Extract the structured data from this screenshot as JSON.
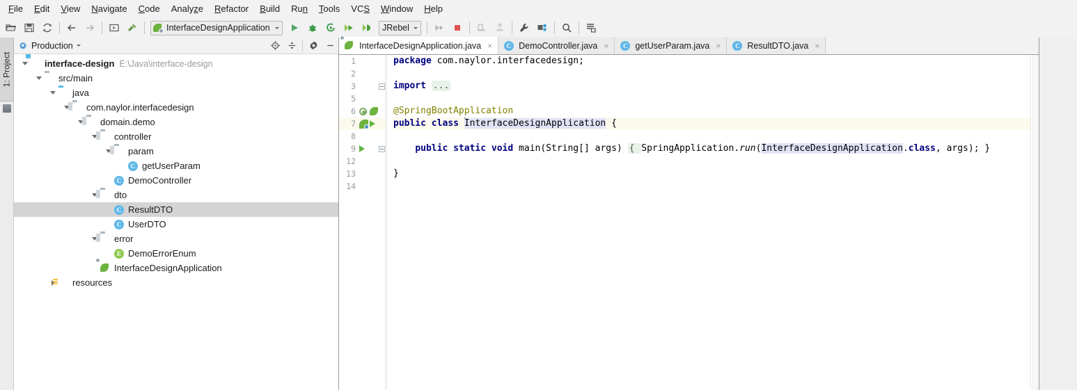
{
  "menubar": {
    "items": [
      {
        "label": "File",
        "mnemonic": "F"
      },
      {
        "label": "Edit",
        "mnemonic": "E"
      },
      {
        "label": "View",
        "mnemonic": "V"
      },
      {
        "label": "Navigate",
        "mnemonic": "N"
      },
      {
        "label": "Code",
        "mnemonic": "C"
      },
      {
        "label": "Analyze",
        "mnemonic": "z"
      },
      {
        "label": "Refactor",
        "mnemonic": "R"
      },
      {
        "label": "Build",
        "mnemonic": "B"
      },
      {
        "label": "Run",
        "mnemonic": "n"
      },
      {
        "label": "Tools",
        "mnemonic": "T"
      },
      {
        "label": "VCS",
        "mnemonic": "S"
      },
      {
        "label": "Window",
        "mnemonic": "W"
      },
      {
        "label": "Help",
        "mnemonic": "H"
      }
    ]
  },
  "toolbar": {
    "buttons": [
      {
        "name": "open-folder-icon",
        "tip": "Open"
      },
      {
        "name": "save-all-icon",
        "tip": "Save All"
      },
      {
        "name": "sync-refresh-icon",
        "tip": "Synchronize"
      },
      {
        "name": "back-arrow-icon",
        "tip": "Back"
      },
      {
        "name": "forward-arrow-icon",
        "tip": "Forward"
      },
      {
        "name": "last-edit-location-icon",
        "tip": "Last Edit Location"
      },
      {
        "name": "build-hammer-icon",
        "tip": "Build Project"
      }
    ],
    "run_config": {
      "label": "InterfaceDesignApplication",
      "icon": "spring-boot-icon"
    },
    "run_buttons": [
      {
        "name": "run-button",
        "tip": "Run"
      },
      {
        "name": "debug-button",
        "tip": "Debug"
      },
      {
        "name": "run-with-coverage-button",
        "tip": "Run with Coverage"
      },
      {
        "name": "jrebel-debug-button",
        "tip": "Debug with JRebel"
      },
      {
        "name": "jrebel-run-button",
        "tip": "Run with JRebel"
      }
    ],
    "jrebel": {
      "label": "JRebel"
    },
    "right_buttons": [
      {
        "name": "attach-profiler-icon",
        "tip": "Profiler"
      },
      {
        "name": "stop-button",
        "tip": "Stop"
      },
      {
        "name": "update-app-icon",
        "tip": "Update Application"
      },
      {
        "name": "rerun-icon",
        "tip": "Rerun"
      },
      {
        "name": "settings-wrench-icon",
        "tip": "Settings"
      },
      {
        "name": "project-structure-icon",
        "tip": "Project Structure"
      },
      {
        "name": "search-everywhere-icon",
        "tip": "Search Everywhere"
      },
      {
        "name": "database-icon",
        "tip": "Database"
      }
    ]
  },
  "toolstrip": {
    "label": "1: Project"
  },
  "project_panel": {
    "scope": "Production",
    "actions": [
      {
        "name": "locate-target-icon",
        "tip": "Select Opened File"
      },
      {
        "name": "collapse-all-icon",
        "tip": "Collapse All"
      },
      {
        "name": "gear-settings-icon",
        "tip": "Settings"
      },
      {
        "name": "hide-panel-icon",
        "tip": "Hide"
      }
    ],
    "tree": [
      {
        "label": "interface-design",
        "path": "E:\\Java\\interface-design",
        "icon": "module-icon",
        "indent": 0,
        "twist": "down",
        "bold": true,
        "selected": false
      },
      {
        "label": "src/main",
        "path": "",
        "icon": "folder-icon",
        "indent": 1,
        "twist": "down",
        "bold": false,
        "selected": false
      },
      {
        "label": "java",
        "path": "",
        "icon": "source-root-icon",
        "indent": 2,
        "twist": "down",
        "bold": false,
        "selected": false
      },
      {
        "label": "com.naylor.interfacedesign",
        "path": "",
        "icon": "package-icon",
        "indent": 3,
        "twist": "down",
        "bold": false,
        "selected": false
      },
      {
        "label": "domain.demo",
        "path": "",
        "icon": "package-icon",
        "indent": 4,
        "twist": "down",
        "bold": false,
        "selected": false
      },
      {
        "label": "controller",
        "path": "",
        "icon": "package-icon",
        "indent": 5,
        "twist": "down",
        "bold": false,
        "selected": false
      },
      {
        "label": "param",
        "path": "",
        "icon": "package-icon",
        "indent": 6,
        "twist": "down",
        "bold": false,
        "selected": false
      },
      {
        "label": "getUserParam",
        "path": "",
        "icon": "java-class-icon",
        "indent": 7,
        "twist": "none",
        "bold": false,
        "selected": false
      },
      {
        "label": "DemoController",
        "path": "",
        "icon": "java-class-icon",
        "indent": 6,
        "twist": "none",
        "bold": false,
        "selected": false
      },
      {
        "label": "dto",
        "path": "",
        "icon": "package-icon",
        "indent": 5,
        "twist": "down",
        "bold": false,
        "selected": false
      },
      {
        "label": "ResultDTO",
        "path": "",
        "icon": "java-class-icon",
        "indent": 6,
        "twist": "none",
        "bold": false,
        "selected": true
      },
      {
        "label": "UserDTO",
        "path": "",
        "icon": "java-class-icon",
        "indent": 6,
        "twist": "none",
        "bold": false,
        "selected": false
      },
      {
        "label": "error",
        "path": "",
        "icon": "package-icon",
        "indent": 5,
        "twist": "down",
        "bold": false,
        "selected": false
      },
      {
        "label": "DemoErrorEnum",
        "path": "",
        "icon": "java-enum-icon",
        "indent": 6,
        "twist": "none",
        "bold": false,
        "selected": false
      },
      {
        "label": "InterfaceDesignApplication",
        "path": "",
        "icon": "spring-boot-class-icon",
        "indent": 5,
        "twist": "none",
        "bold": false,
        "selected": false
      },
      {
        "label": "resources",
        "path": "",
        "icon": "resources-root-icon",
        "indent": 2,
        "twist": "right",
        "bold": false,
        "selected": false
      }
    ]
  },
  "editor": {
    "tabs": [
      {
        "label": "InterfaceDesignApplication.java",
        "icon": "spring-boot-class-icon",
        "active": true,
        "close": "×"
      },
      {
        "label": "DemoController.java",
        "icon": "java-class-icon",
        "active": false,
        "close": "×"
      },
      {
        "label": "getUserParam.java",
        "icon": "java-class-icon",
        "active": false,
        "close": "×"
      },
      {
        "label": "ResultDTO.java",
        "icon": "java-class-icon",
        "active": false,
        "close": "×"
      }
    ],
    "lines": [
      {
        "num": "1",
        "gutter": [],
        "fold": "",
        "caretline": false,
        "tokens": [
          {
            "t": "package",
            "c": "kw"
          },
          {
            "t": " com.naylor.interfacedesign;",
            "c": ""
          }
        ]
      },
      {
        "num": "2",
        "gutter": [],
        "fold": "",
        "caretline": false,
        "tokens": []
      },
      {
        "num": "3",
        "gutter": [],
        "fold": "minus",
        "caretline": false,
        "tokens": [
          {
            "t": "import",
            "c": "kw"
          },
          {
            "t": " ",
            "c": ""
          },
          {
            "t": "...",
            "c": "fold-ph"
          }
        ]
      },
      {
        "num": "5",
        "gutter": [],
        "fold": "",
        "caretline": false,
        "tokens": []
      },
      {
        "num": "6",
        "gutter": [
          "bean-icon",
          "spring-leaf-icon"
        ],
        "fold": "",
        "caretline": false,
        "tokens": [
          {
            "t": "@SpringBootApplication",
            "c": "ann"
          }
        ]
      },
      {
        "num": "7",
        "gutter": [
          "spring-nav-icon",
          "run-icon"
        ],
        "fold": "",
        "caretline": true,
        "tokens": [
          {
            "t": "public",
            "c": "kw"
          },
          {
            "t": " ",
            "c": ""
          },
          {
            "t": "class",
            "c": "kw"
          },
          {
            "t": " ",
            "c": ""
          },
          {
            "t": "CARET",
            "c": "caret"
          },
          {
            "t": "InterfaceDesignApplication",
            "c": "ident-hl"
          },
          {
            "t": " {",
            "c": ""
          }
        ]
      },
      {
        "num": "8",
        "gutter": [],
        "fold": "",
        "caretline": false,
        "tokens": []
      },
      {
        "num": "9",
        "gutter": [
          "run-icon"
        ],
        "fold": "minus",
        "caretline": false,
        "tokens": [
          {
            "t": "    ",
            "c": ""
          },
          {
            "t": "public",
            "c": "kw"
          },
          {
            "t": " ",
            "c": ""
          },
          {
            "t": "static",
            "c": "kw"
          },
          {
            "t": " ",
            "c": ""
          },
          {
            "t": "void",
            "c": "kw"
          },
          {
            "t": " main(String[] args) ",
            "c": ""
          },
          {
            "t": "{ ",
            "c": "fold-ph"
          },
          {
            "t": "SpringApplication.",
            "c": ""
          },
          {
            "t": "run",
            "c": "italic"
          },
          {
            "t": "(",
            "c": ""
          },
          {
            "t": "InterfaceDesignApplication",
            "c": "ident-hl"
          },
          {
            "t": ".",
            "c": ""
          },
          {
            "t": "class",
            "c": "kw"
          },
          {
            "t": ", args); }",
            "c": ""
          }
        ]
      },
      {
        "num": "12",
        "gutter": [],
        "fold": "",
        "caretline": false,
        "tokens": []
      },
      {
        "num": "13",
        "gutter": [],
        "fold": "",
        "caretline": false,
        "tokens": [
          {
            "t": "}",
            "c": ""
          }
        ]
      },
      {
        "num": "14",
        "gutter": [],
        "fold": "",
        "caretline": false,
        "tokens": []
      }
    ]
  },
  "colors": {
    "chrome": "#f2f2f2",
    "editor_bg": "#ffffff",
    "selection": "#d4d4d4",
    "caret_line": "#fcfaed",
    "keyword": "#000080",
    "annotation": "#808000",
    "identifier_highlight": "#e2e2f7",
    "fold_placeholder": "#e8f2e8",
    "spring_green": "#6db33f",
    "run_green": "#62b543",
    "class_icon_blue": "#5fb8e8",
    "enum_icon_green": "#8ec94f"
  }
}
